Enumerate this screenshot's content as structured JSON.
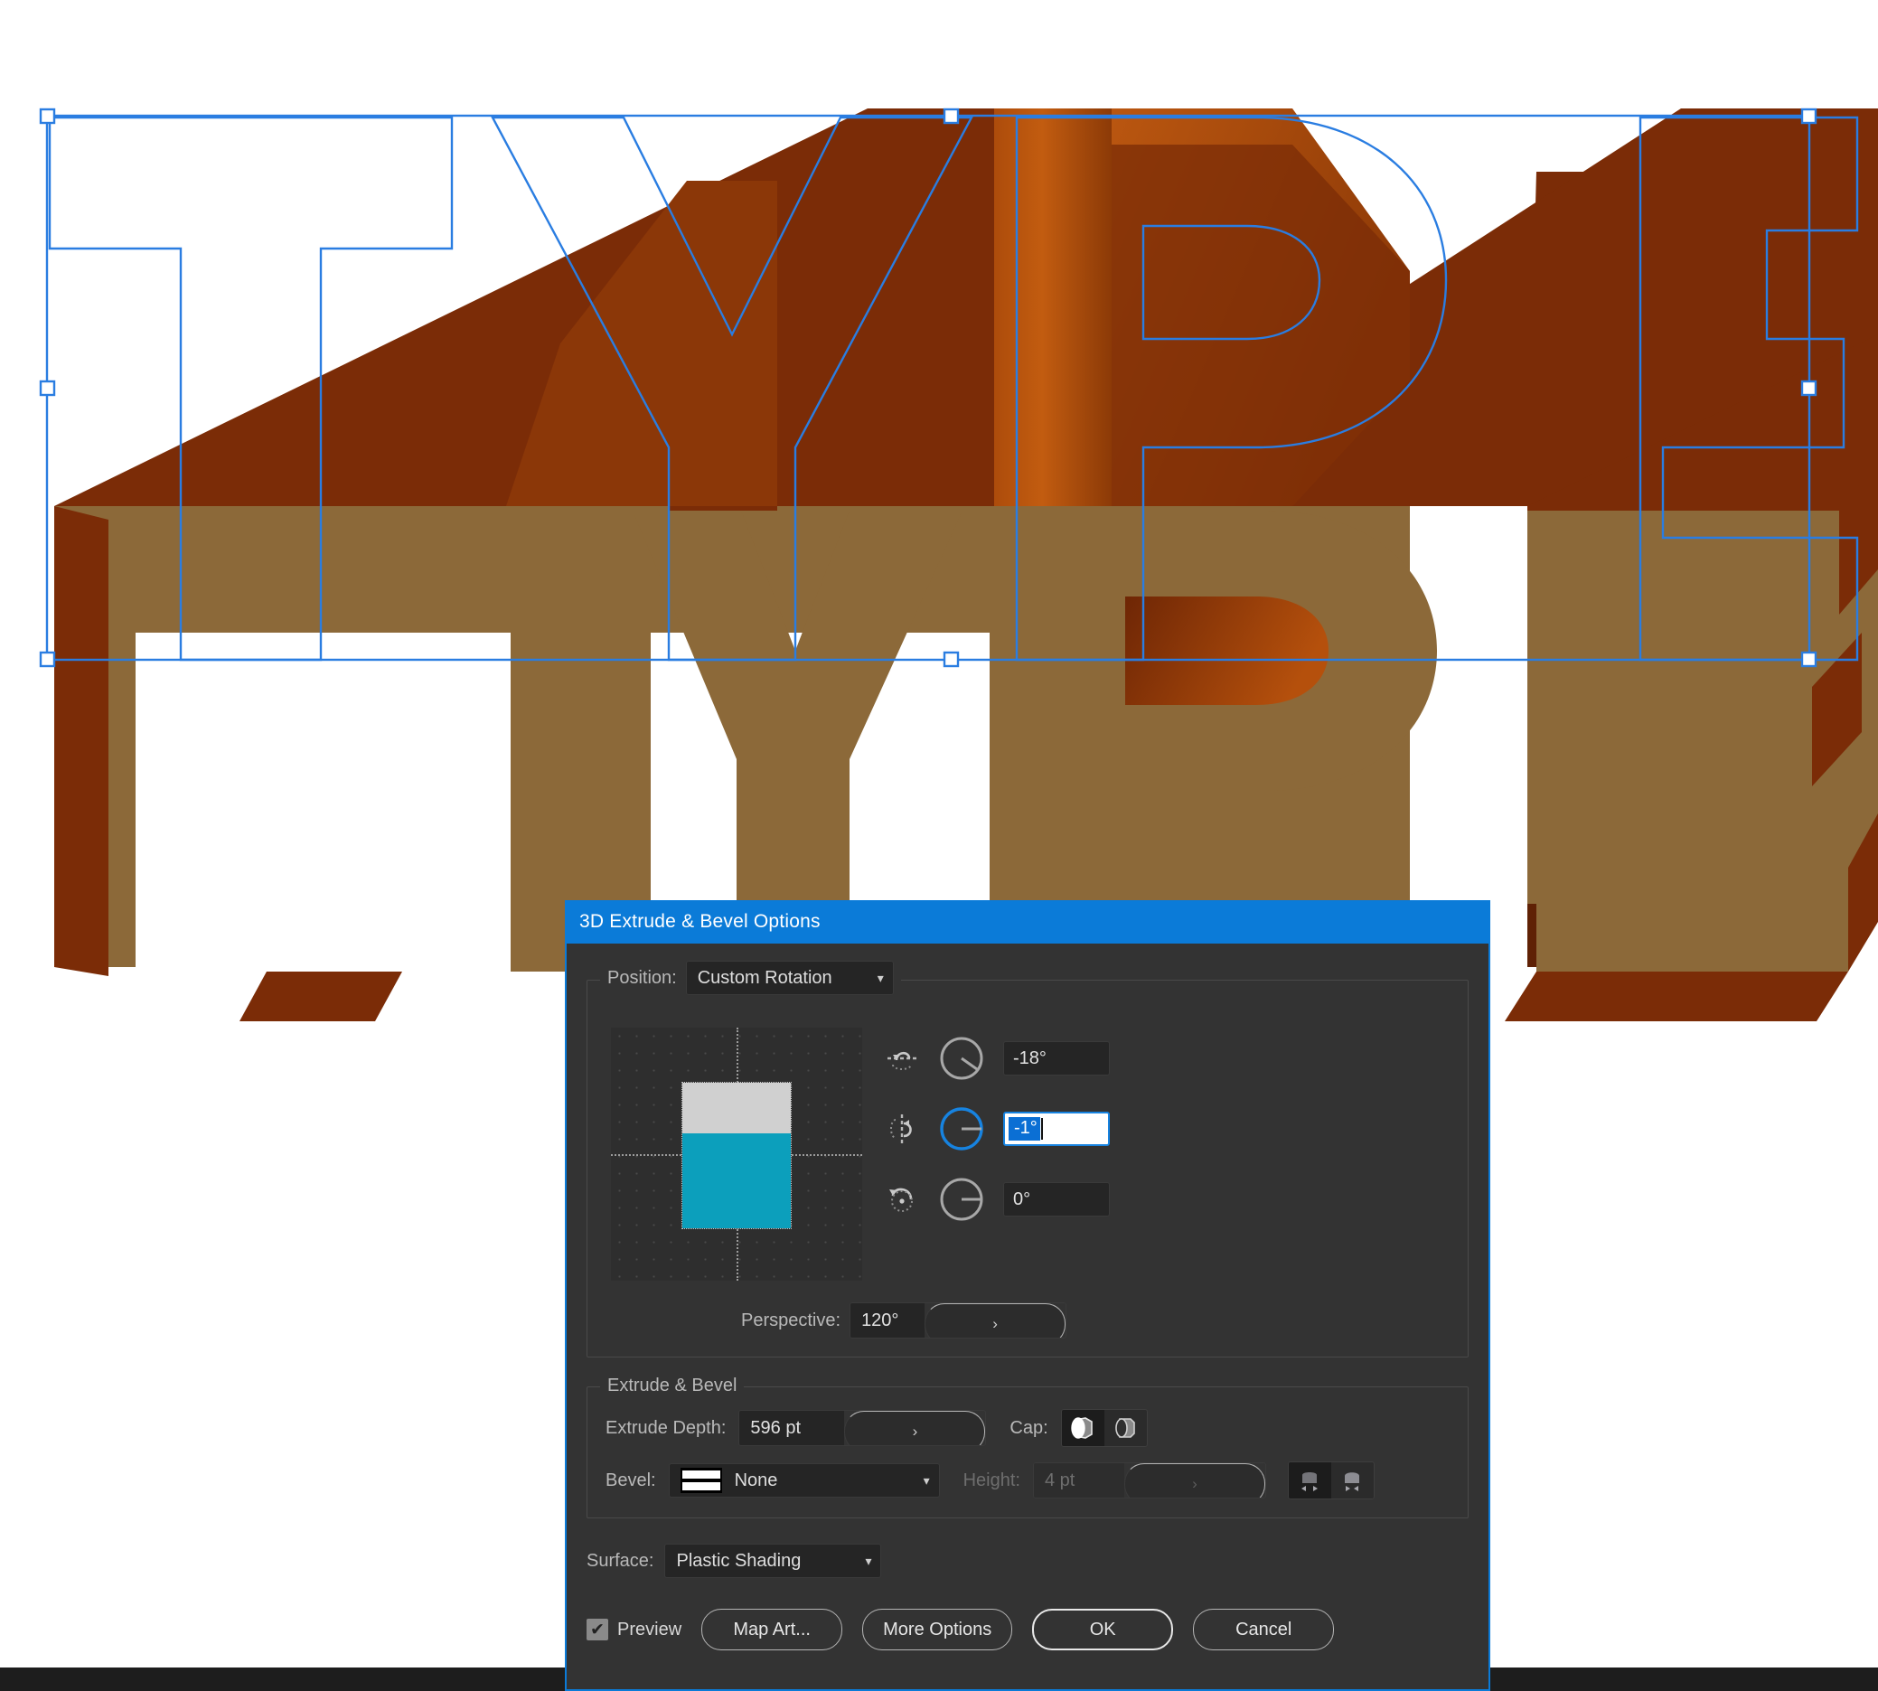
{
  "app": {
    "canvas_background": "#ffffff",
    "selection_color": "#2a7de1",
    "artwork": {
      "text": "TYPE",
      "front_face_color": "#8c6939",
      "extrude_dark_color": "#7b2c07",
      "extrude_mid_color": "#a14609",
      "extrude_light_color": "#c35a10",
      "outline_color": "#2a7de1"
    }
  },
  "dialog": {
    "title": "3D Extrude & Bevel Options",
    "title_color": "#0b7bd8",
    "position": {
      "label": "Position:",
      "value": "Custom Rotation"
    },
    "rotation": {
      "x": {
        "icon": "rotate-x-icon",
        "value": "-18°",
        "active": false
      },
      "y": {
        "icon": "rotate-y-icon",
        "value": "-1°",
        "active": true
      },
      "z": {
        "icon": "rotate-z-icon",
        "value": "0°",
        "active": false
      }
    },
    "perspective": {
      "label": "Perspective:",
      "value": "120°",
      "stepper_icon": "chevron-right-icon"
    },
    "extrude_bevel": {
      "legend": "Extrude & Bevel",
      "extrude_depth": {
        "label": "Extrude Depth:",
        "value": "596 pt"
      },
      "cap": {
        "label": "Cap:",
        "options": [
          "solid-cap-icon",
          "hollow-cap-icon"
        ],
        "selected_index": 0
      },
      "bevel": {
        "label": "Bevel:",
        "value": "None",
        "swatch": "bevel-none-swatch"
      },
      "height": {
        "label": "Height:",
        "value": "4 pt",
        "disabled": true
      },
      "bevel_extent": {
        "options": [
          "bevel-extent-out-icon",
          "bevel-extent-in-icon"
        ],
        "selected_index": 0
      }
    },
    "surface": {
      "label": "Surface:",
      "value": "Plastic Shading"
    },
    "footer": {
      "preview_label": "Preview",
      "preview_checked": true,
      "check_glyph": "✔",
      "buttons": [
        {
          "label": "Map Art...",
          "default": false
        },
        {
          "label": "More Options",
          "default": false
        },
        {
          "label": "OK",
          "default": true
        },
        {
          "label": "Cancel",
          "default": false
        }
      ]
    }
  }
}
